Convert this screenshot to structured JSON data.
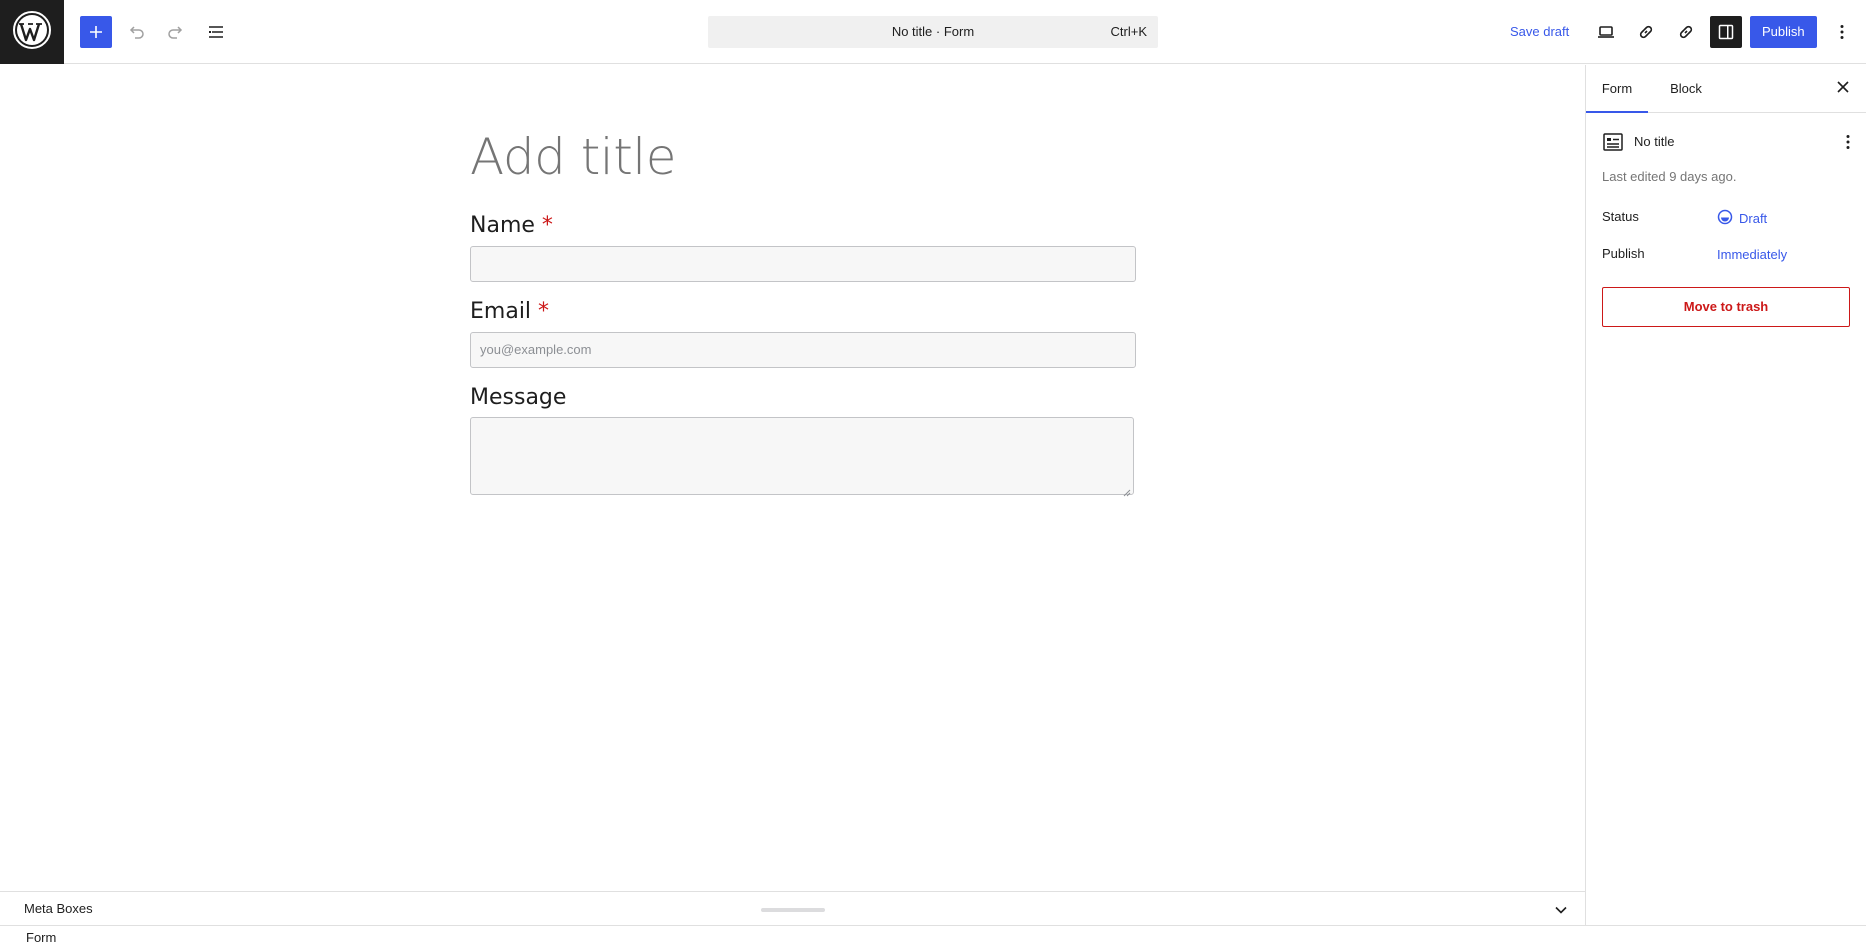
{
  "toolbar": {
    "wp_logo_icon": "wordpress-logo-icon",
    "add_block_icon": "plus-icon",
    "undo_icon": "undo-icon",
    "redo_icon": "redo-icon",
    "document_overview_icon": "list-view-icon",
    "command_bar": {
      "title": "No title · Form",
      "shortcut": "Ctrl+K"
    },
    "save_draft_label": "Save draft",
    "preview_icon": "desktop-preview-icon",
    "link_icon_1": "link-icon",
    "link_icon_2": "link-icon",
    "settings_icon": "sidebar-settings-icon",
    "publish_label": "Publish",
    "more_icon": "vertical-ellipsis-icon",
    "accent_color": "#3858e9"
  },
  "editor": {
    "title_placeholder": "Add title",
    "fields": [
      {
        "label": "Name",
        "required_mark": "*",
        "placeholder": ""
      },
      {
        "label": "Email",
        "required_mark": "*",
        "placeholder": "you@example.com"
      },
      {
        "label": "Message",
        "required_mark": ""
      }
    ],
    "required_color": "#cc1818"
  },
  "meta_boxes": {
    "title": "Meta Boxes",
    "toggle_icon": "chevron-down-icon"
  },
  "footer": {
    "breadcrumb": "Form"
  },
  "sidebar": {
    "tabs": [
      {
        "label": "Form",
        "active": true
      },
      {
        "label": "Block",
        "active": false
      }
    ],
    "close_icon": "close-icon",
    "document": {
      "icon": "form-icon",
      "title": "No title",
      "more_icon": "vertical-ellipsis-icon",
      "last_edited": "Last edited 9 days ago."
    },
    "properties": {
      "status_label": "Status",
      "status_value": "Draft",
      "status_icon": "draft-status-icon",
      "publish_label": "Publish",
      "publish_value": "Immediately"
    },
    "trash_label": "Move to trash",
    "trash_color": "#cc1818"
  }
}
